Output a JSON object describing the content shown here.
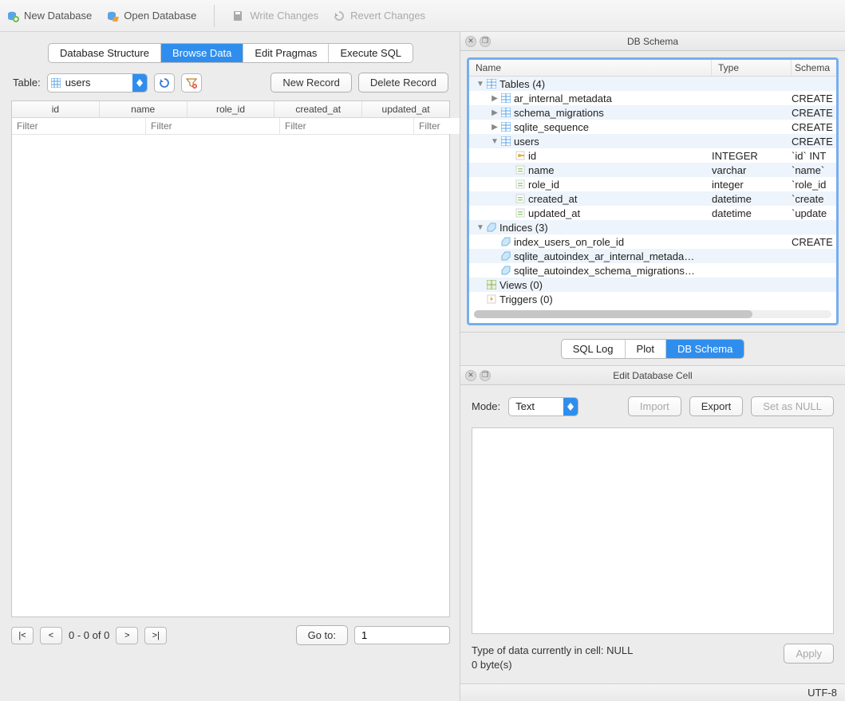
{
  "toolbar": {
    "new_db": "New Database",
    "open_db": "Open Database",
    "write_changes": "Write Changes",
    "revert_changes": "Revert Changes"
  },
  "main_tabs": {
    "structure": "Database Structure",
    "browse": "Browse Data",
    "pragmas": "Edit Pragmas",
    "sql": "Execute SQL"
  },
  "browse": {
    "table_label": "Table:",
    "table_value": "users",
    "new_record": "New Record",
    "delete_record": "Delete Record",
    "columns": [
      "id",
      "name",
      "role_id",
      "created_at",
      "updated_at"
    ],
    "filter_placeholder": "Filter",
    "pager": {
      "first": "|<",
      "prev": "<",
      "status": "0 - 0 of 0",
      "next": ">",
      "last": ">|",
      "goto_label": "Go to:",
      "goto_value": "1"
    }
  },
  "schema_panel": {
    "title": "DB Schema",
    "headers": {
      "name": "Name",
      "type": "Type",
      "schema": "Schema"
    },
    "rows": [
      {
        "indent": 0,
        "toggle": "down",
        "icon": "table-group",
        "name": "Tables (4)",
        "type": "",
        "schema": "",
        "alt": true
      },
      {
        "indent": 1,
        "toggle": "right",
        "icon": "table",
        "name": "ar_internal_metadata",
        "type": "",
        "schema": "CREATE",
        "alt": false
      },
      {
        "indent": 1,
        "toggle": "right",
        "icon": "table",
        "name": "schema_migrations",
        "type": "",
        "schema": "CREATE",
        "alt": true
      },
      {
        "indent": 1,
        "toggle": "right",
        "icon": "table",
        "name": "sqlite_sequence",
        "type": "",
        "schema": "CREATE",
        "alt": false
      },
      {
        "indent": 1,
        "toggle": "down",
        "icon": "table",
        "name": "users",
        "type": "",
        "schema": "CREATE",
        "alt": true
      },
      {
        "indent": 2,
        "toggle": "",
        "icon": "key",
        "name": "id",
        "type": "INTEGER",
        "schema": "`id` INT",
        "alt": false
      },
      {
        "indent": 2,
        "toggle": "",
        "icon": "field",
        "name": "name",
        "type": "varchar",
        "schema": "`name`",
        "alt": true
      },
      {
        "indent": 2,
        "toggle": "",
        "icon": "field",
        "name": "role_id",
        "type": "integer",
        "schema": "`role_id",
        "alt": false
      },
      {
        "indent": 2,
        "toggle": "",
        "icon": "field",
        "name": "created_at",
        "type": "datetime",
        "schema": "`create",
        "alt": true
      },
      {
        "indent": 2,
        "toggle": "",
        "icon": "field",
        "name": "updated_at",
        "type": "datetime",
        "schema": "`update",
        "alt": false
      },
      {
        "indent": 0,
        "toggle": "down",
        "icon": "index-group",
        "name": "Indices (3)",
        "type": "",
        "schema": "",
        "alt": true
      },
      {
        "indent": 1,
        "toggle": "",
        "icon": "index",
        "name": "index_users_on_role_id",
        "type": "",
        "schema": "CREATE",
        "alt": false
      },
      {
        "indent": 1,
        "toggle": "",
        "icon": "index",
        "name": "sqlite_autoindex_ar_internal_metada…",
        "type": "",
        "schema": "",
        "alt": true
      },
      {
        "indent": 1,
        "toggle": "",
        "icon": "index",
        "name": "sqlite_autoindex_schema_migrations…",
        "type": "",
        "schema": "",
        "alt": false
      },
      {
        "indent": 0,
        "toggle": "",
        "icon": "view-group",
        "name": "Views (0)",
        "type": "",
        "schema": "",
        "alt": true
      },
      {
        "indent": 0,
        "toggle": "",
        "icon": "trigger-group",
        "name": "Triggers (0)",
        "type": "",
        "schema": "",
        "alt": false
      }
    ],
    "tabs": {
      "sql_log": "SQL Log",
      "plot": "Plot",
      "db_schema": "DB Schema"
    }
  },
  "cell_panel": {
    "title": "Edit Database Cell",
    "mode_label": "Mode:",
    "mode_value": "Text",
    "import": "Import",
    "export": "Export",
    "set_null": "Set as NULL",
    "info_line1": "Type of data currently in cell: NULL",
    "info_line2": "0 byte(s)",
    "apply": "Apply"
  },
  "statusbar": {
    "encoding": "UTF-8"
  }
}
